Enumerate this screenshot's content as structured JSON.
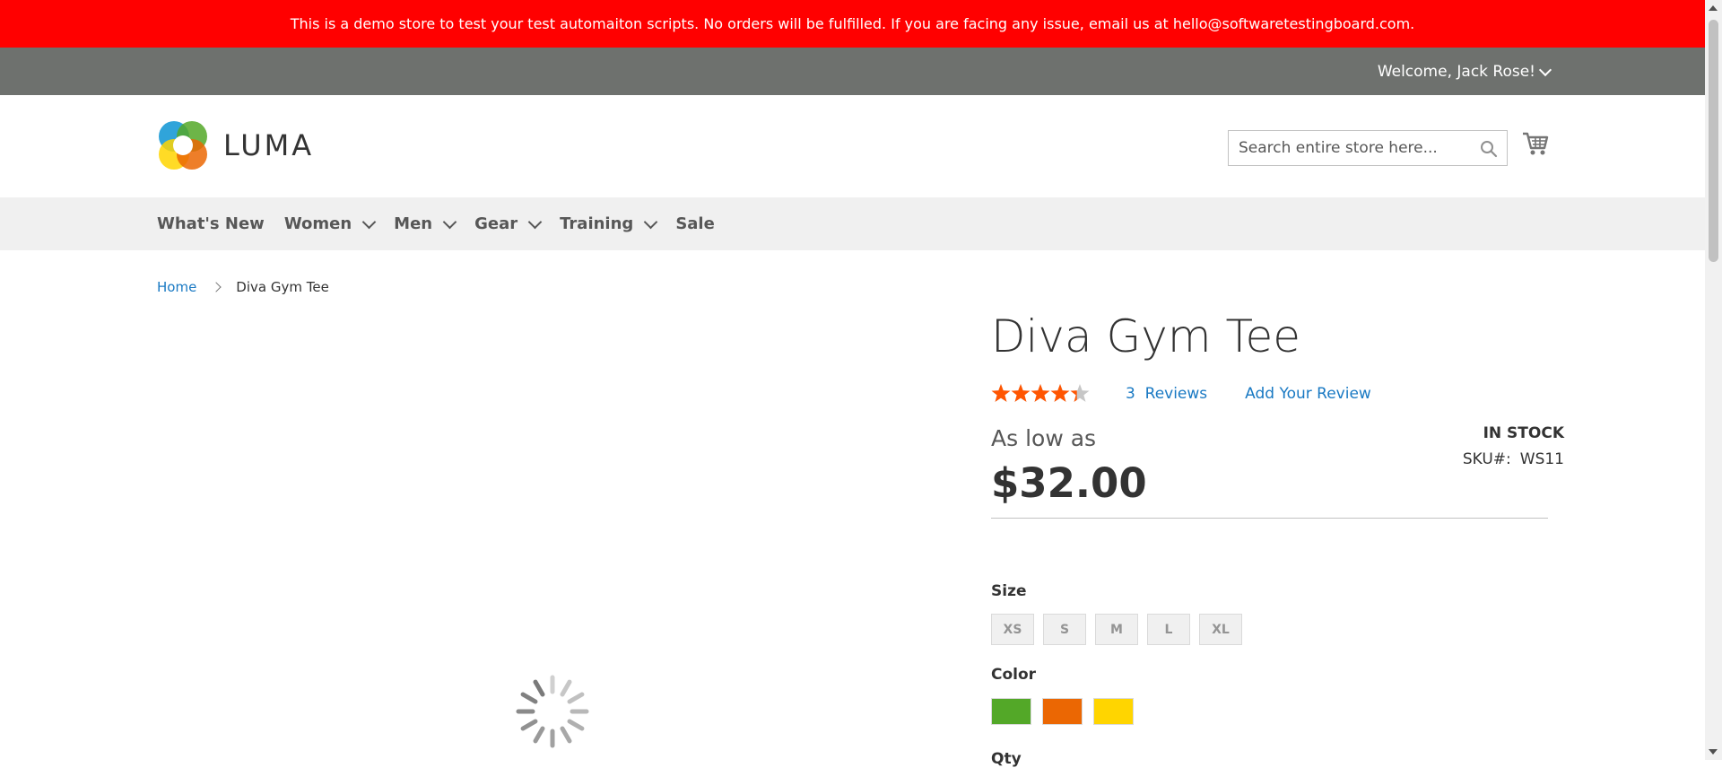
{
  "demo_notice": "This is a demo store to test your test automaiton scripts. No orders will be fulfilled. If you are facing any issue, email us at hello@softwaretestingboard.com.",
  "header": {
    "welcome": "Welcome, Jack Rose!",
    "logo_text": "LUMA",
    "search_placeholder": "Search entire store here..."
  },
  "nav": {
    "items": [
      {
        "label": "What's New",
        "has_dropdown": false
      },
      {
        "label": "Women",
        "has_dropdown": true
      },
      {
        "label": "Men",
        "has_dropdown": true
      },
      {
        "label": "Gear",
        "has_dropdown": true
      },
      {
        "label": "Training",
        "has_dropdown": true
      },
      {
        "label": "Sale",
        "has_dropdown": false
      }
    ]
  },
  "breadcrumb": {
    "home": "Home",
    "current": "Diva Gym Tee"
  },
  "product": {
    "title": "Diva Gym Tee",
    "rating_fraction": 0.87,
    "reviews_count": "3",
    "reviews_label": "Reviews",
    "add_review": "Add Your Review",
    "price_prefix": "As low as",
    "price": "$32.00",
    "stock": "IN STOCK",
    "sku_label": "SKU#:",
    "sku": "WS11"
  },
  "options": {
    "size_label": "Size",
    "sizes": [
      "XS",
      "S",
      "M",
      "L",
      "XL"
    ],
    "color_label": "Color",
    "colors": [
      "#53a828",
      "#eb6703",
      "#ffd500"
    ],
    "qty_label": "Qty"
  },
  "colors": {
    "demo_bar": "#ff0000",
    "panel_header": "#6e716e",
    "link": "#1979c3",
    "star_filled": "#ff5501",
    "star_empty": "#c7c7c7"
  }
}
